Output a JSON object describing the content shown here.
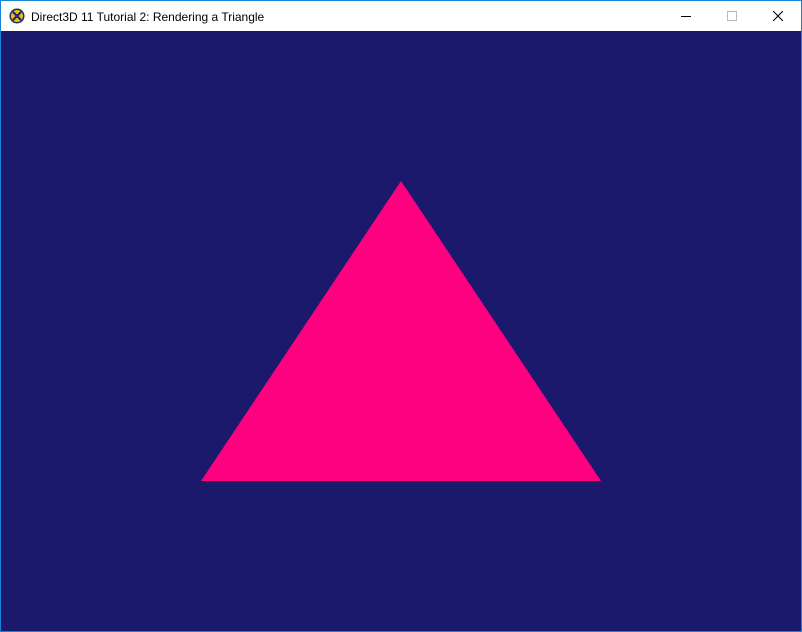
{
  "window": {
    "title": "Direct3D 11 Tutorial 2: Rendering a Triangle",
    "app_icon": "directx-icon",
    "controls": {
      "minimize": "minimize-icon",
      "maximize": "maximize-icon",
      "close": "close-icon"
    },
    "border_color": "#1883d7"
  },
  "viewport": {
    "clear_color": "#1b196b",
    "triangle": {
      "fill_color": "#ff007f",
      "vertices": [
        [
          0.0,
          0.5
        ],
        [
          0.5,
          -0.5
        ],
        [
          -0.5,
          -0.5
        ]
      ]
    }
  }
}
